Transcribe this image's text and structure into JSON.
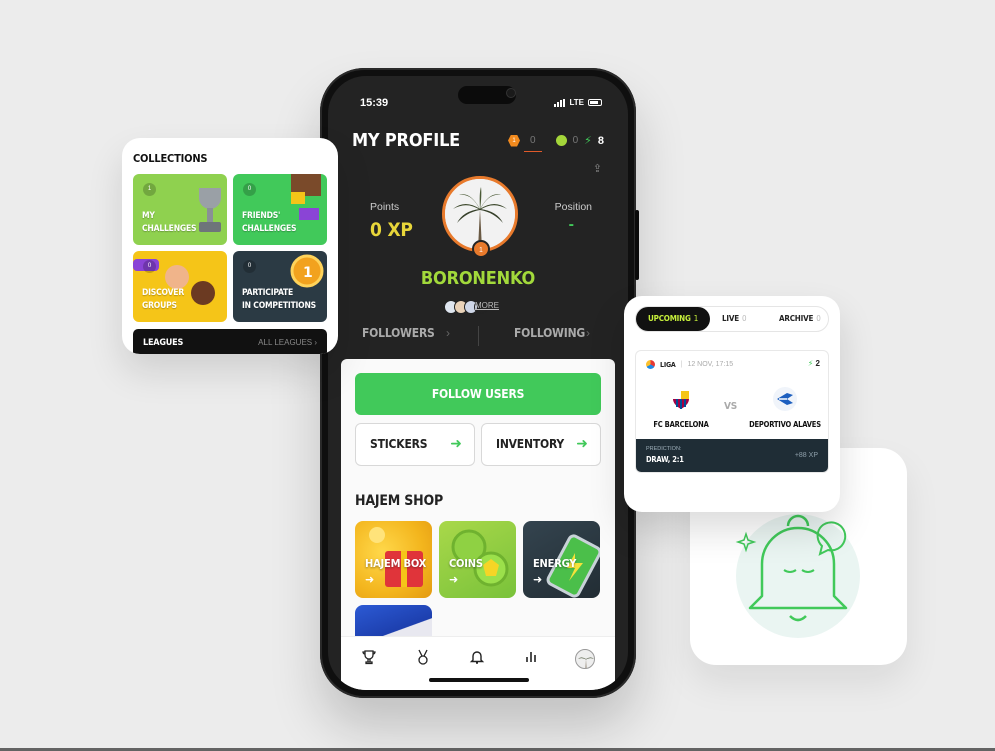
{
  "status_bar": {
    "time": "15:39",
    "network": "LTE"
  },
  "profile": {
    "title": "MY PROFILE",
    "stats": {
      "streak_badge": "1",
      "streak_count": "0",
      "coins": "0",
      "energy": "8"
    },
    "points_label": "Points",
    "points_value": "0 XP",
    "position_label": "Position",
    "position_value": "-",
    "avatar_level": "1",
    "username": "BORONENKO",
    "more_label": "MORE",
    "followers_label": "FOLLOWERS",
    "following_label": "FOLLOWING"
  },
  "actions": {
    "follow_users": "FOLLOW USERS",
    "stickers": "STICKERS",
    "inventory": "INVENTORY"
  },
  "shop": {
    "title": "HAJEM SHOP",
    "items": [
      {
        "label": "HAJEM BOX"
      },
      {
        "label": "COINS"
      },
      {
        "label": "ENERGY"
      }
    ]
  },
  "tabbar": {
    "items": [
      "trophy-icon",
      "medal-icon",
      "bell-icon",
      "chart-icon",
      "profile-avatar"
    ]
  },
  "collections": {
    "title": "COLLECTIONS",
    "tiles": [
      {
        "badge": "1",
        "label": "MY\nCHALLENGES",
        "color": "#8fd14f"
      },
      {
        "badge": "0",
        "label": "FRIENDS'\nCHALLENGES",
        "color": "#41c95a"
      },
      {
        "badge": "0",
        "label": "DISCOVER\nGROUPS",
        "color": "#f5c518"
      },
      {
        "badge": "0",
        "label": "PARTICIPATE\nIN COMPETITIONS",
        "color": "#2b3a44"
      }
    ],
    "leagues_label": "LEAGUES",
    "all_leagues_label": "ALL LEAGUES"
  },
  "matches": {
    "tabs": [
      {
        "label": "UPCOMING",
        "count": "1"
      },
      {
        "label": "LIVE",
        "count": "0"
      },
      {
        "label": "ARCHIVE",
        "count": "0"
      }
    ],
    "card": {
      "league": "LIGA",
      "date": "12 NOV, 17:15",
      "energy": "2",
      "home_team": "FC BARCELONA",
      "vs": "VS",
      "away_team": "DEPORTIVO ALAVES",
      "prediction_label": "PREDICTION:",
      "prediction_value": "DRAW, 2:1",
      "xp": "+88 XP"
    }
  },
  "colors": {
    "accent_green": "#41c95a",
    "lime": "#a2d93b",
    "orange": "#e87a2c",
    "dark": "#232323"
  }
}
